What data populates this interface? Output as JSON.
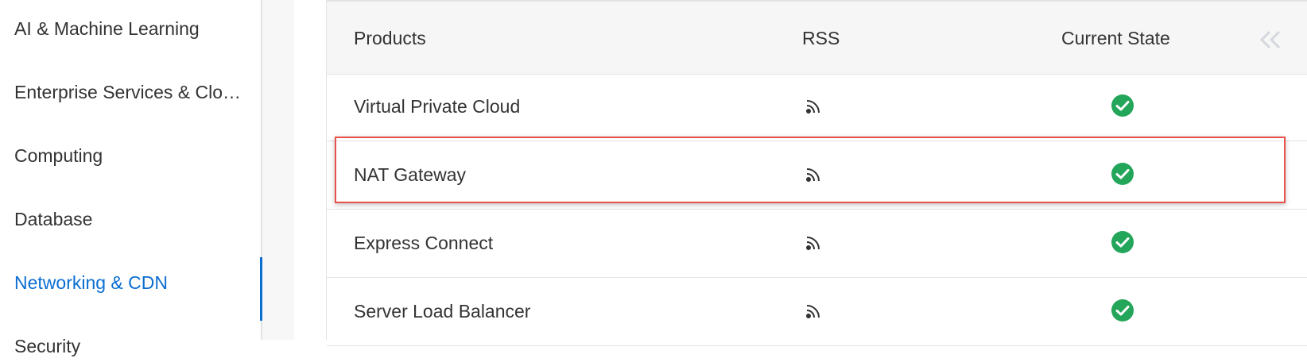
{
  "sidebar": {
    "items": [
      {
        "label": "AI & Machine Learning",
        "active": false
      },
      {
        "label": "Enterprise Services & Clo…",
        "active": false
      },
      {
        "label": "Computing",
        "active": false
      },
      {
        "label": "Database",
        "active": false
      },
      {
        "label": "Networking & CDN",
        "active": true
      },
      {
        "label": "Security",
        "active": false
      }
    ],
    "active_color": "#0a6ed1"
  },
  "table": {
    "columns": [
      "Products",
      "RSS",
      "Current State"
    ],
    "collapse_icon": "double-chevron-left-icon",
    "rows": [
      {
        "product": "Virtual Private Cloud",
        "rss_icon": "rss-icon",
        "state": "normal",
        "highlighted": false
      },
      {
        "product": "NAT Gateway",
        "rss_icon": "rss-icon",
        "state": "normal",
        "highlighted": true
      },
      {
        "product": "Express Connect",
        "rss_icon": "rss-icon",
        "state": "normal",
        "highlighted": false
      },
      {
        "product": "Server Load Balancer",
        "rss_icon": "rss-icon",
        "state": "normal",
        "highlighted": false
      }
    ],
    "state_color": "#23a55a",
    "highlight_color": "#e8504a"
  }
}
